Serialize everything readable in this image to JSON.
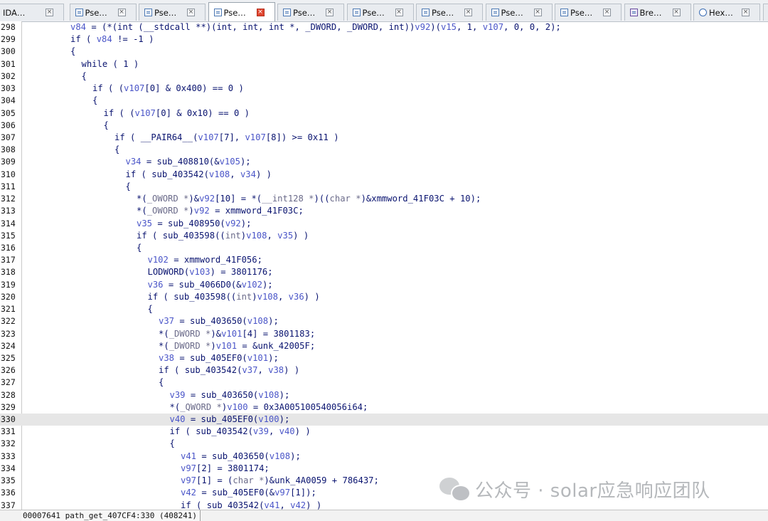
{
  "tabs": [
    {
      "label": "IDA…",
      "icon": "ida-view-icon",
      "active": false
    },
    {
      "label": "Pse…",
      "icon": "pseudocode-icon",
      "active": false
    },
    {
      "label": "Pse…",
      "icon": "pseudocode-icon",
      "active": false
    },
    {
      "label": "Pse…",
      "icon": "pseudocode-icon",
      "active": true
    },
    {
      "label": "Pse…",
      "icon": "pseudocode-icon",
      "active": false
    },
    {
      "label": "Pse…",
      "icon": "pseudocode-icon",
      "active": false
    },
    {
      "label": "Pse…",
      "icon": "pseudocode-icon",
      "active": false
    },
    {
      "label": "Pse…",
      "icon": "pseudocode-icon",
      "active": false
    },
    {
      "label": "Pse…",
      "icon": "pseudocode-icon",
      "active": false
    },
    {
      "label": "Bre…",
      "icon": "breakpoints-icon",
      "active": false
    },
    {
      "label": "Hex…",
      "icon": "hex-view-icon",
      "active": false
    },
    {
      "label": "A",
      "icon": "structures-icon",
      "active": false
    }
  ],
  "tab_close_glyph": "×",
  "highlighted_line": 330,
  "lines": [
    {
      "num": "298",
      "indent": 8,
      "toks": [
        [
          "v",
          "v84"
        ],
        [
          "c",
          " = (*(int (__stdcall **)(int, int, int *, _DWORD, _DWORD, int))"
        ],
        [
          "v",
          "v92"
        ],
        [
          "c",
          ")("
        ],
        [
          "v",
          "v15"
        ],
        [
          "c",
          ", 1, "
        ],
        [
          "v",
          "v107"
        ],
        [
          "c",
          ", 0, 0, 2);"
        ]
      ]
    },
    {
      "num": "299",
      "indent": 8,
      "toks": [
        [
          "k",
          "if"
        ],
        [
          "c",
          " ( "
        ],
        [
          "v",
          "v84"
        ],
        [
          "c",
          " != -1 )"
        ]
      ]
    },
    {
      "num": "300",
      "indent": 8,
      "toks": [
        [
          "c",
          "{"
        ]
      ]
    },
    {
      "num": "301",
      "indent": 10,
      "toks": [
        [
          "k",
          "while"
        ],
        [
          "c",
          " ( 1 )"
        ]
      ]
    },
    {
      "num": "302",
      "indent": 10,
      "toks": [
        [
          "c",
          "{"
        ]
      ]
    },
    {
      "num": "303",
      "indent": 12,
      "toks": [
        [
          "k",
          "if"
        ],
        [
          "c",
          " ( ("
        ],
        [
          "v",
          "v107"
        ],
        [
          "c",
          "[0] & 0x400) == 0 )"
        ]
      ]
    },
    {
      "num": "304",
      "indent": 12,
      "toks": [
        [
          "c",
          "{"
        ]
      ]
    },
    {
      "num": "305",
      "indent": 14,
      "toks": [
        [
          "k",
          "if"
        ],
        [
          "c",
          " ( ("
        ],
        [
          "v",
          "v107"
        ],
        [
          "c",
          "[0] & 0x10) == 0 )"
        ]
      ]
    },
    {
      "num": "306",
      "indent": 14,
      "toks": [
        [
          "c",
          "{"
        ]
      ]
    },
    {
      "num": "307",
      "indent": 16,
      "toks": [
        [
          "k",
          "if"
        ],
        [
          "c",
          " ( __PAIR64__("
        ],
        [
          "v",
          "v107"
        ],
        [
          "c",
          "[7], "
        ],
        [
          "v",
          "v107"
        ],
        [
          "c",
          "[8]) >= 0x11 )"
        ]
      ]
    },
    {
      "num": "308",
      "indent": 16,
      "toks": [
        [
          "c",
          "{"
        ]
      ]
    },
    {
      "num": "309",
      "indent": 18,
      "toks": [
        [
          "v",
          "v34"
        ],
        [
          "c",
          " = sub_408810(&"
        ],
        [
          "v",
          "v105"
        ],
        [
          "c",
          ");"
        ]
      ]
    },
    {
      "num": "310",
      "indent": 18,
      "toks": [
        [
          "k",
          "if"
        ],
        [
          "c",
          " ( sub_403542("
        ],
        [
          "v",
          "v108"
        ],
        [
          "c",
          ", "
        ],
        [
          "v",
          "v34"
        ],
        [
          "c",
          ") )"
        ]
      ]
    },
    {
      "num": "311",
      "indent": 18,
      "toks": [
        [
          "c",
          "{"
        ]
      ]
    },
    {
      "num": "312",
      "indent": 20,
      "toks": [
        [
          "c",
          "*("
        ],
        [
          "g",
          "_OWORD *"
        ],
        [
          "c",
          ")&"
        ],
        [
          "v",
          "v92"
        ],
        [
          "c",
          "[10] = *("
        ],
        [
          "g",
          "__int128 *"
        ],
        [
          "c",
          ")(("
        ],
        [
          "g",
          "char *"
        ],
        [
          "c",
          ")&xmmword_41F03C + 10);"
        ]
      ]
    },
    {
      "num": "313",
      "indent": 20,
      "toks": [
        [
          "c",
          "*("
        ],
        [
          "g",
          "_OWORD *"
        ],
        [
          "c",
          ")"
        ],
        [
          "v",
          "v92"
        ],
        [
          "c",
          " = xmmword_41F03C;"
        ]
      ]
    },
    {
      "num": "314",
      "indent": 20,
      "toks": [
        [
          "v",
          "v35"
        ],
        [
          "c",
          " = sub_408950("
        ],
        [
          "v",
          "v92"
        ],
        [
          "c",
          ");"
        ]
      ]
    },
    {
      "num": "315",
      "indent": 20,
      "toks": [
        [
          "k",
          "if"
        ],
        [
          "c",
          " ( sub_403598(("
        ],
        [
          "g",
          "int"
        ],
        [
          "c",
          ")"
        ],
        [
          "v",
          "v108"
        ],
        [
          "c",
          ", "
        ],
        [
          "v",
          "v35"
        ],
        [
          "c",
          ") )"
        ]
      ]
    },
    {
      "num": "316",
      "indent": 20,
      "toks": [
        [
          "c",
          "{"
        ]
      ]
    },
    {
      "num": "317",
      "indent": 22,
      "toks": [
        [
          "v",
          "v102"
        ],
        [
          "c",
          " = xmmword_41F056;"
        ]
      ]
    },
    {
      "num": "318",
      "indent": 22,
      "toks": [
        [
          "c",
          "LODWORD("
        ],
        [
          "v",
          "v103"
        ],
        [
          "c",
          ") = 3801176;"
        ]
      ]
    },
    {
      "num": "319",
      "indent": 22,
      "toks": [
        [
          "v",
          "v36"
        ],
        [
          "c",
          " = sub_4066D0(&"
        ],
        [
          "v",
          "v102"
        ],
        [
          "c",
          ");"
        ]
      ]
    },
    {
      "num": "320",
      "indent": 22,
      "toks": [
        [
          "k",
          "if"
        ],
        [
          "c",
          " ( sub_403598(("
        ],
        [
          "g",
          "int"
        ],
        [
          "c",
          ")"
        ],
        [
          "v",
          "v108"
        ],
        [
          "c",
          ", "
        ],
        [
          "v",
          "v36"
        ],
        [
          "c",
          ") )"
        ]
      ]
    },
    {
      "num": "321",
      "indent": 22,
      "toks": [
        [
          "c",
          "{"
        ]
      ]
    },
    {
      "num": "322",
      "indent": 24,
      "toks": [
        [
          "v",
          "v37"
        ],
        [
          "c",
          " = sub_403650("
        ],
        [
          "v",
          "v108"
        ],
        [
          "c",
          ");"
        ]
      ]
    },
    {
      "num": "323",
      "indent": 24,
      "toks": [
        [
          "c",
          "*("
        ],
        [
          "g",
          "_DWORD *"
        ],
        [
          "c",
          ")&"
        ],
        [
          "v",
          "v101"
        ],
        [
          "c",
          "[4] = 3801183;"
        ]
      ]
    },
    {
      "num": "324",
      "indent": 24,
      "toks": [
        [
          "c",
          "*("
        ],
        [
          "g",
          "_DWORD *"
        ],
        [
          "c",
          ")"
        ],
        [
          "v",
          "v101"
        ],
        [
          "c",
          " = &unk_42005F;"
        ]
      ]
    },
    {
      "num": "325",
      "indent": 24,
      "toks": [
        [
          "v",
          "v38"
        ],
        [
          "c",
          " = sub_405EF0("
        ],
        [
          "v",
          "v101"
        ],
        [
          "c",
          ");"
        ]
      ]
    },
    {
      "num": "326",
      "indent": 24,
      "toks": [
        [
          "k",
          "if"
        ],
        [
          "c",
          " ( sub_403542("
        ],
        [
          "v",
          "v37"
        ],
        [
          "c",
          ", "
        ],
        [
          "v",
          "v38"
        ],
        [
          "c",
          ") )"
        ]
      ]
    },
    {
      "num": "327",
      "indent": 24,
      "toks": [
        [
          "c",
          "{"
        ]
      ]
    },
    {
      "num": "328",
      "indent": 26,
      "toks": [
        [
          "v",
          "v39"
        ],
        [
          "c",
          " = sub_403650("
        ],
        [
          "v",
          "v108"
        ],
        [
          "c",
          ");"
        ]
      ]
    },
    {
      "num": "329",
      "indent": 26,
      "toks": [
        [
          "c",
          "*("
        ],
        [
          "g",
          "_QWORD *"
        ],
        [
          "c",
          ")"
        ],
        [
          "v",
          "v100"
        ],
        [
          "c",
          " = 0x3A005100540056i64;"
        ]
      ]
    },
    {
      "num": "330",
      "indent": 26,
      "toks": [
        [
          "v",
          "v40"
        ],
        [
          "c",
          " = sub_405EF0("
        ],
        [
          "v",
          "v100"
        ],
        [
          "c",
          ");"
        ]
      ]
    },
    {
      "num": "331",
      "indent": 26,
      "toks": [
        [
          "k",
          "if"
        ],
        [
          "c",
          " ( sub_403542("
        ],
        [
          "v",
          "v39"
        ],
        [
          "c",
          ", "
        ],
        [
          "v",
          "v40"
        ],
        [
          "c",
          ") )"
        ]
      ]
    },
    {
      "num": "332",
      "indent": 26,
      "toks": [
        [
          "c",
          "{"
        ]
      ]
    },
    {
      "num": "333",
      "indent": 28,
      "toks": [
        [
          "v",
          "v41"
        ],
        [
          "c",
          " = sub_403650("
        ],
        [
          "v",
          "v108"
        ],
        [
          "c",
          ");"
        ]
      ]
    },
    {
      "num": "334",
      "indent": 28,
      "toks": [
        [
          "v",
          "v97"
        ],
        [
          "c",
          "[2] = 3801174;"
        ]
      ]
    },
    {
      "num": "335",
      "indent": 28,
      "toks": [
        [
          "v",
          "v97"
        ],
        [
          "c",
          "[1] = ("
        ],
        [
          "g",
          "char *"
        ],
        [
          "c",
          ")&unk_4A0059 + 786437;"
        ]
      ]
    },
    {
      "num": "336",
      "indent": 28,
      "toks": [
        [
          "v",
          "v42"
        ],
        [
          "c",
          " = sub_405EF0(&"
        ],
        [
          "v",
          "v97"
        ],
        [
          "c",
          "[1]);"
        ]
      ]
    },
    {
      "num": "337",
      "indent": 28,
      "toks": [
        [
          "k",
          "if"
        ],
        [
          "c",
          " ( sub_403542("
        ],
        [
          "v",
          "v41"
        ],
        [
          "c",
          ", "
        ],
        [
          "v",
          "v42"
        ],
        [
          "c",
          ") )"
        ]
      ]
    }
  ],
  "status": {
    "location": "00007641 path_get_407CF4:330 (408241)"
  },
  "watermark": {
    "text": "公众号 · solar应急响应团队",
    "icon": "wechat-logo-icon"
  },
  "colors": {
    "variable": "#4a55c8",
    "code": "#0a1470",
    "type_cast": "#6b6b8a",
    "highlight_line": "#e6e6e6",
    "active_tab_close": "#e0452f"
  }
}
